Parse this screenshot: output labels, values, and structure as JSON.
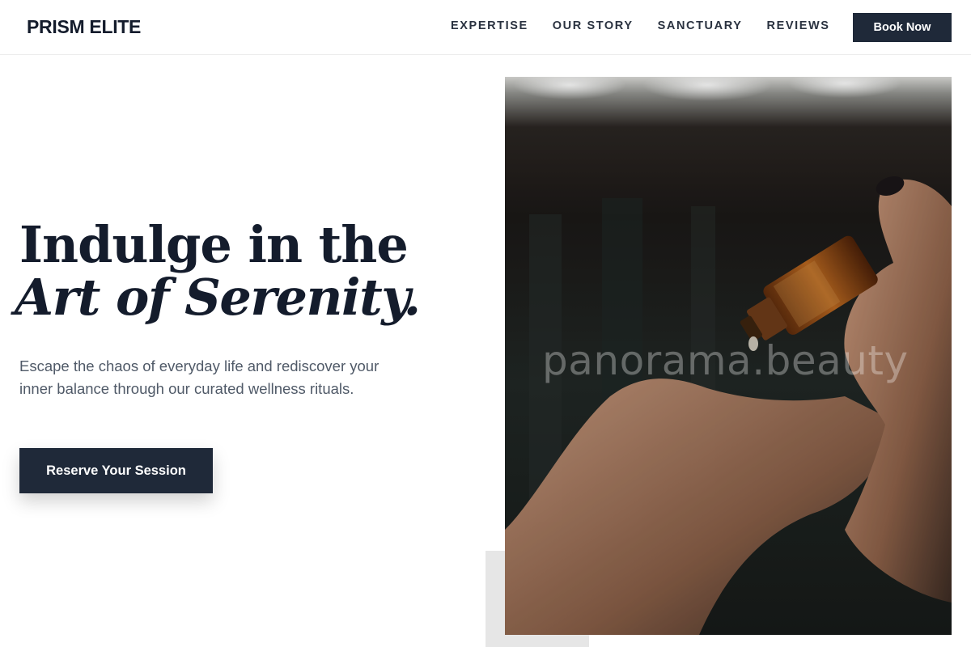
{
  "header": {
    "brand": "PRISM ELITE",
    "nav": [
      {
        "label": "EXPERTISE"
      },
      {
        "label": "OUR STORY"
      },
      {
        "label": "SANCTUARY"
      },
      {
        "label": "REVIEWS"
      }
    ],
    "book_label": "Book Now"
  },
  "hero": {
    "title_line1": "Indulge in the",
    "title_line2": "Art of Serenity.",
    "subtitle": "Escape the chaos of everyday life and rediscover your inner balance through our curated wellness rituals.",
    "cta_label": "Reserve Your Session"
  },
  "image": {
    "subject": "hand-dripping-essential-oil",
    "watermark": "panorama.beauty"
  },
  "colors": {
    "primary": "#1f2939",
    "heading": "#141c2c",
    "body_text": "#505a68",
    "accent_block": "#e6e6e6"
  }
}
